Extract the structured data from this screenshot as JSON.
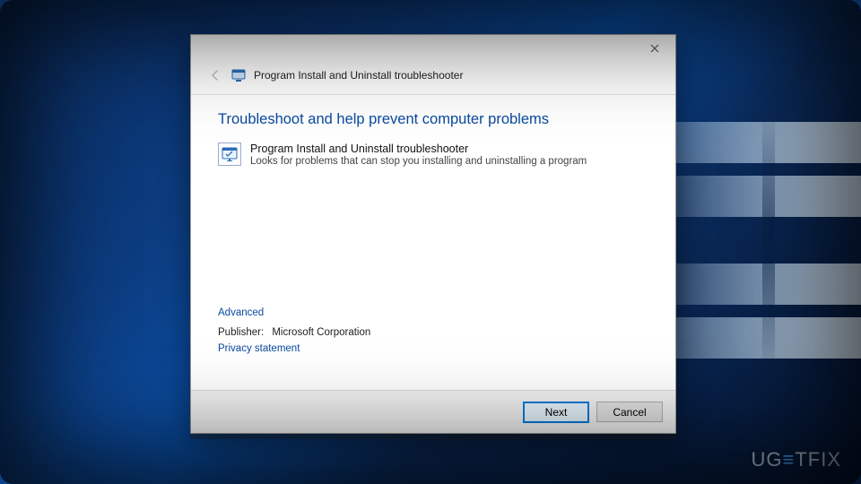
{
  "dialog": {
    "header_title": "Program Install and Uninstall troubleshooter",
    "page_heading": "Troubleshoot and help prevent computer problems",
    "item": {
      "title": "Program Install and Uninstall troubleshooter",
      "description": "Looks for problems that can stop you installing and uninstalling a program"
    },
    "links": {
      "advanced": "Advanced",
      "publisher_label": "Publisher:",
      "publisher_value": "Microsoft Corporation",
      "privacy": "Privacy statement"
    },
    "buttons": {
      "next": "Next",
      "cancel": "Cancel"
    }
  },
  "watermark": {
    "pre": "UG",
    "accent": "≡",
    "post": "TFIX"
  }
}
